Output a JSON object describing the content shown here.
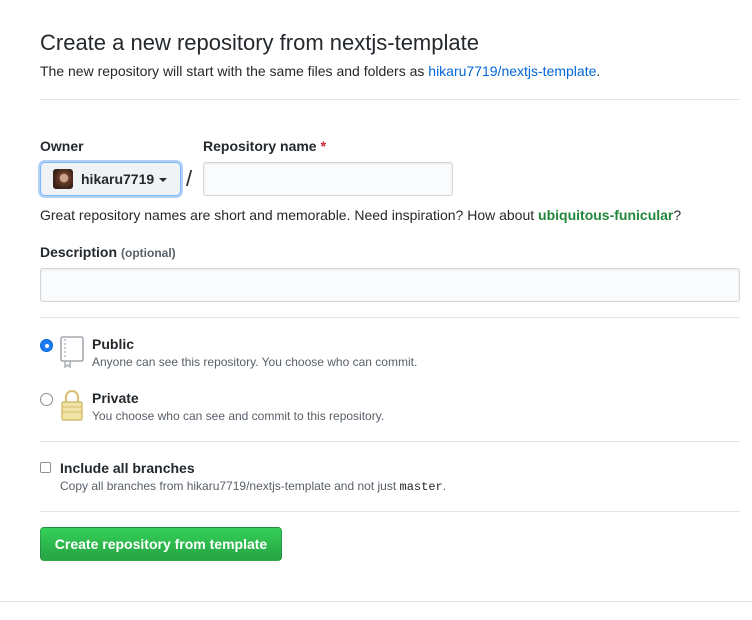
{
  "header": {
    "title": "Create a new repository from nextjs-template",
    "subtitle_prefix": "The new repository will start with the same files and folders as ",
    "template_link": "hikaru7719/nextjs-template",
    "subtitle_suffix": "."
  },
  "owner": {
    "label": "Owner",
    "selected": "hikaru7719",
    "avatar_icon": "user-avatar"
  },
  "separator": "/",
  "repo_name": {
    "label": "Repository name",
    "required_mark": "*",
    "value": "",
    "placeholder": ""
  },
  "hint": {
    "text": "Great repository names are short and memorable. Need inspiration? How about ",
    "suggestion": "ubiquitous-funicular",
    "suffix": "?"
  },
  "description": {
    "label": "Description",
    "optional_note": "(optional)",
    "value": "",
    "placeholder": ""
  },
  "visibility": {
    "selected": "public",
    "options": [
      {
        "id": "public",
        "title": "Public",
        "description": "Anyone can see this repository. You choose who can commit.",
        "icon": "repo-book-icon"
      },
      {
        "id": "private",
        "title": "Private",
        "description": "You choose who can see and commit to this repository.",
        "icon": "lock-icon"
      }
    ]
  },
  "include_branches": {
    "label": "Include all branches",
    "checked": false,
    "description_prefix": "Copy all branches from hikaru7719/nextjs-template and not just ",
    "description_code": "master",
    "description_suffix": "."
  },
  "submit": {
    "label": "Create repository from template"
  },
  "colors": {
    "link": "#0366d6",
    "required": "#cb2431",
    "suggestion": "#22863a",
    "primary_button": "#28a745",
    "radio_selected": "#1f7bf2"
  }
}
